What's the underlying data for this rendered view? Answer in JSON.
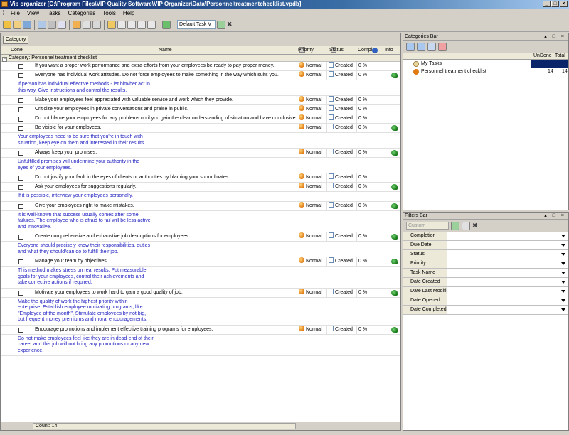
{
  "window": {
    "title": "Vip organizer [C:\\Program Files\\VIP Quality Software\\VIP Organizer\\Data\\Personneltreatmentchecklist.vpdb]",
    "min": "_",
    "max": "□",
    "close": "×"
  },
  "menu": [
    "File",
    "View",
    "Tasks",
    "Categories",
    "Tools",
    "Help"
  ],
  "toolbar": {
    "view_combo": "Default Task V",
    "delete_glyph": "✖"
  },
  "grid": {
    "group_chip": "Category",
    "columns": {
      "done": "Done",
      "name": "Name",
      "priority": "Priority",
      "status": "Status",
      "compl": "Compl",
      "info": "Info"
    },
    "category_label": "Category: Personnel treatment checklist",
    "tasks": [
      {
        "name": "If you want a proper work performance and extra-efforts from your employees be ready to pay proper money.",
        "priority": "Normal",
        "status": "Created",
        "compl": "0 %",
        "info": false,
        "note": ""
      },
      {
        "name": "Everyone has individual work attitudes. Do not force employees to make something in the way which suits you.",
        "priority": "Normal",
        "status": "Created",
        "compl": "0 %",
        "info": true,
        "note": "If person has individual effective methods - let him/her act in\nthis way. Give instructions and control the results."
      },
      {
        "name": "Make your employees feel appreciated with valuable service and work which they provide.",
        "priority": "Normal",
        "status": "Created",
        "compl": "0 %",
        "info": false,
        "note": ""
      },
      {
        "name": "Criticize your employees in private conversations and praise in public.",
        "priority": "Normal",
        "status": "Created",
        "compl": "0 %",
        "info": false,
        "note": ""
      },
      {
        "name": "Do not blame your employees for any problems until you gain the clear understanding of situation and have conclusive",
        "priority": "Normal",
        "status": "Created",
        "compl": "0 %",
        "info": false,
        "note": ""
      },
      {
        "name": "Be visible for your employees.",
        "priority": "Normal",
        "status": "Created",
        "compl": "0 %",
        "info": true,
        "note": "Your employees need to be sure that you're in touch with\nsituation, keep eye on them and interested in their results."
      },
      {
        "name": "Always keep your promises.",
        "priority": "Normal",
        "status": "Created",
        "compl": "0 %",
        "info": true,
        "note": "Unfulfilled promises will undermine your authority in the\neyes of your employees."
      },
      {
        "name": "Do not justify your fault in the eyes of clients or authorities by blaming your subordinates",
        "priority": "Normal",
        "status": "Created",
        "compl": "0 %",
        "info": false,
        "note": ""
      },
      {
        "name": "Ask your employees for suggestions regularly.",
        "priority": "Normal",
        "status": "Created",
        "compl": "0 %",
        "info": true,
        "note": "If it is possible, interview your employees personally."
      },
      {
        "name": "Give your employees right to make mistakes.",
        "priority": "Normal",
        "status": "Created",
        "compl": "0 %",
        "info": true,
        "note": "It is well-known that success usually comes after some\nfailures. The employee who is afraid to fail will be less active\nand innovative."
      },
      {
        "name": "Create comprehensive and exhaustive job descriptions for employees.",
        "priority": "Normal",
        "status": "Created",
        "compl": "0 %",
        "info": true,
        "note": "Everyone should precisely know their responsibilities, duties\nand what they should/can do to fulfill their job."
      },
      {
        "name": "Manage your team by objectives.",
        "priority": "Normal",
        "status": "Created",
        "compl": "0 %",
        "info": true,
        "note": "This method makes stress on real results. Put measurable\ngoals for your employees, control their achievements and\ntake corrective actions if required."
      },
      {
        "name": "Motivate your employees to work hard to gain a good quality of job.",
        "priority": "Normal",
        "status": "Created",
        "compl": "0 %",
        "info": true,
        "note": "Make the quality of work the highest priority within\nenterprise. Establish employee motivating programs, like\n\"Employee of the month\". Stimulate employees by not big,\nbut frequent money premiums and moral encouragements."
      },
      {
        "name": "Encourage promotions and implement effective training programs for employees.",
        "priority": "Normal",
        "status": "Created",
        "compl": "0 %",
        "info": true,
        "note": "Do not make employees feel like they are in dead-end of their\ncareer and this job will not bring any promotions or any new\nexperience."
      }
    ],
    "count": "Count: 14"
  },
  "categories_bar": {
    "title": "Categories Bar",
    "controls": "▴ □ ×",
    "col_undone": "UnDone",
    "col_total": "Total",
    "items": [
      {
        "label": "My Tasks",
        "undone": "",
        "total": ""
      },
      {
        "label": "Personnel treatment checklist",
        "undone": "14",
        "total": "14"
      }
    ]
  },
  "filters_bar": {
    "title": "Filters Bar",
    "controls": "▴ □ ×",
    "preset": "Custom",
    "fields": [
      "Completion",
      "Due Date",
      "Status",
      "Priority",
      "Task Name",
      "Date Created",
      "Date Last Modifi",
      "Date Opened",
      "Date Completed"
    ]
  },
  "colors": {
    "note_text": "#2020c0",
    "selection": "#0a246a",
    "title_bar": "#0a246a"
  }
}
